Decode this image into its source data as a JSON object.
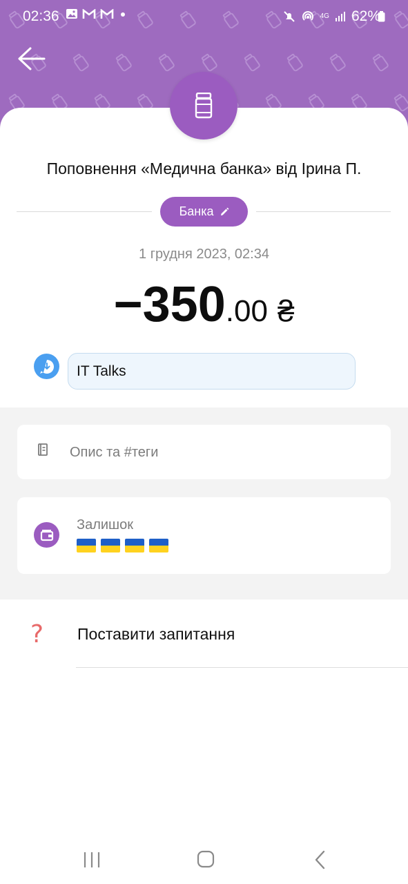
{
  "status_bar": {
    "time": "02:36",
    "battery": "62%",
    "network": "4G"
  },
  "colors": {
    "header_bg": "#9e6bbf",
    "accent": "#9b5cc0",
    "message_icon": "#4a9ff0",
    "question_icon": "#e86a6a"
  },
  "header": {
    "back_icon": "arrow-left-icon",
    "badge_icon": "jar-icon"
  },
  "transaction": {
    "title": "Поповнення «Медична банка» від Ірина П.",
    "category_label": "Банка",
    "category_icon": "pencil-icon",
    "datetime": "1 грудня 2023, 02:34",
    "amount_main": "−350",
    "amount_cents": ".00",
    "currency": "₴",
    "message": "IT Talks"
  },
  "description": {
    "placeholder": "Опис та #теги"
  },
  "balance": {
    "label": "Залишок",
    "flags_icon": "ukraine-flag-icon"
  },
  "help": {
    "label": "Поставити запитання",
    "icon": "question-icon"
  },
  "navbar": {
    "icons": [
      "recent-apps-icon",
      "home-icon",
      "back-icon"
    ]
  }
}
